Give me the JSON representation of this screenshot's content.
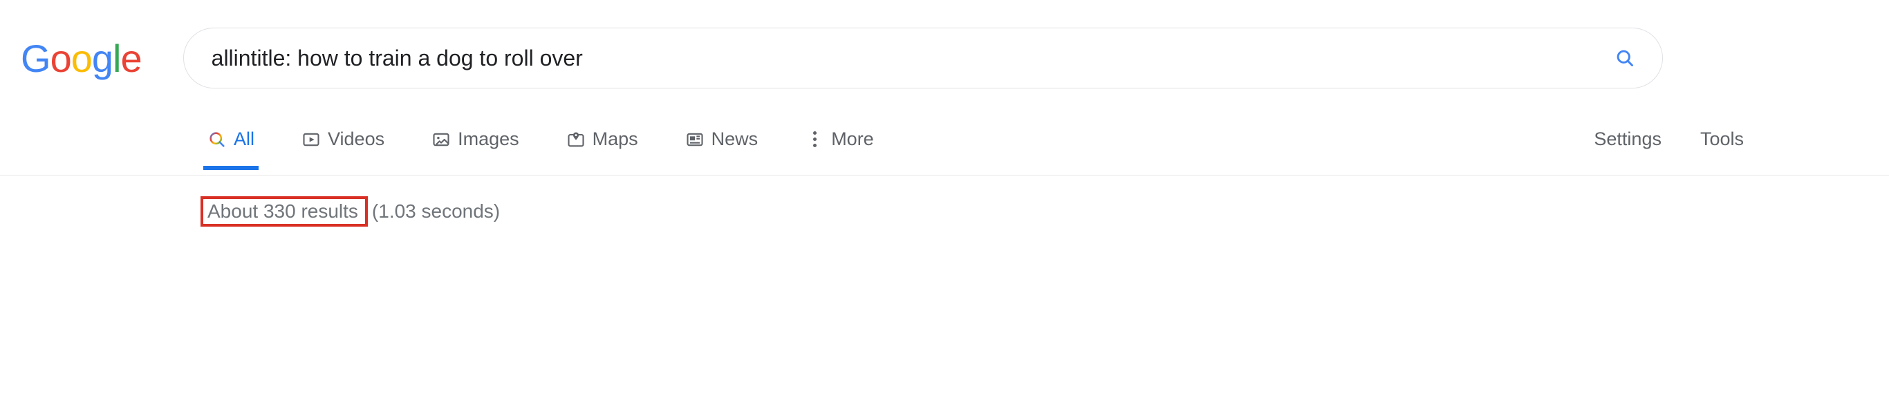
{
  "logo": {
    "letters": [
      {
        "char": "G",
        "color": "#4285F4"
      },
      {
        "char": "o",
        "color": "#EA4335"
      },
      {
        "char": "o",
        "color": "#FBBC05"
      },
      {
        "char": "g",
        "color": "#4285F4"
      },
      {
        "char": "l",
        "color": "#34A853"
      },
      {
        "char": "e",
        "color": "#EA4335"
      }
    ]
  },
  "search": {
    "value": "allintitle: how to train a dog to roll over"
  },
  "tabs": {
    "all": "All",
    "videos": "Videos",
    "images": "Images",
    "maps": "Maps",
    "news": "News",
    "more": "More"
  },
  "links": {
    "settings": "Settings",
    "tools": "Tools"
  },
  "stats": {
    "results": "About 330 results",
    "time": "(1.03 seconds)"
  }
}
